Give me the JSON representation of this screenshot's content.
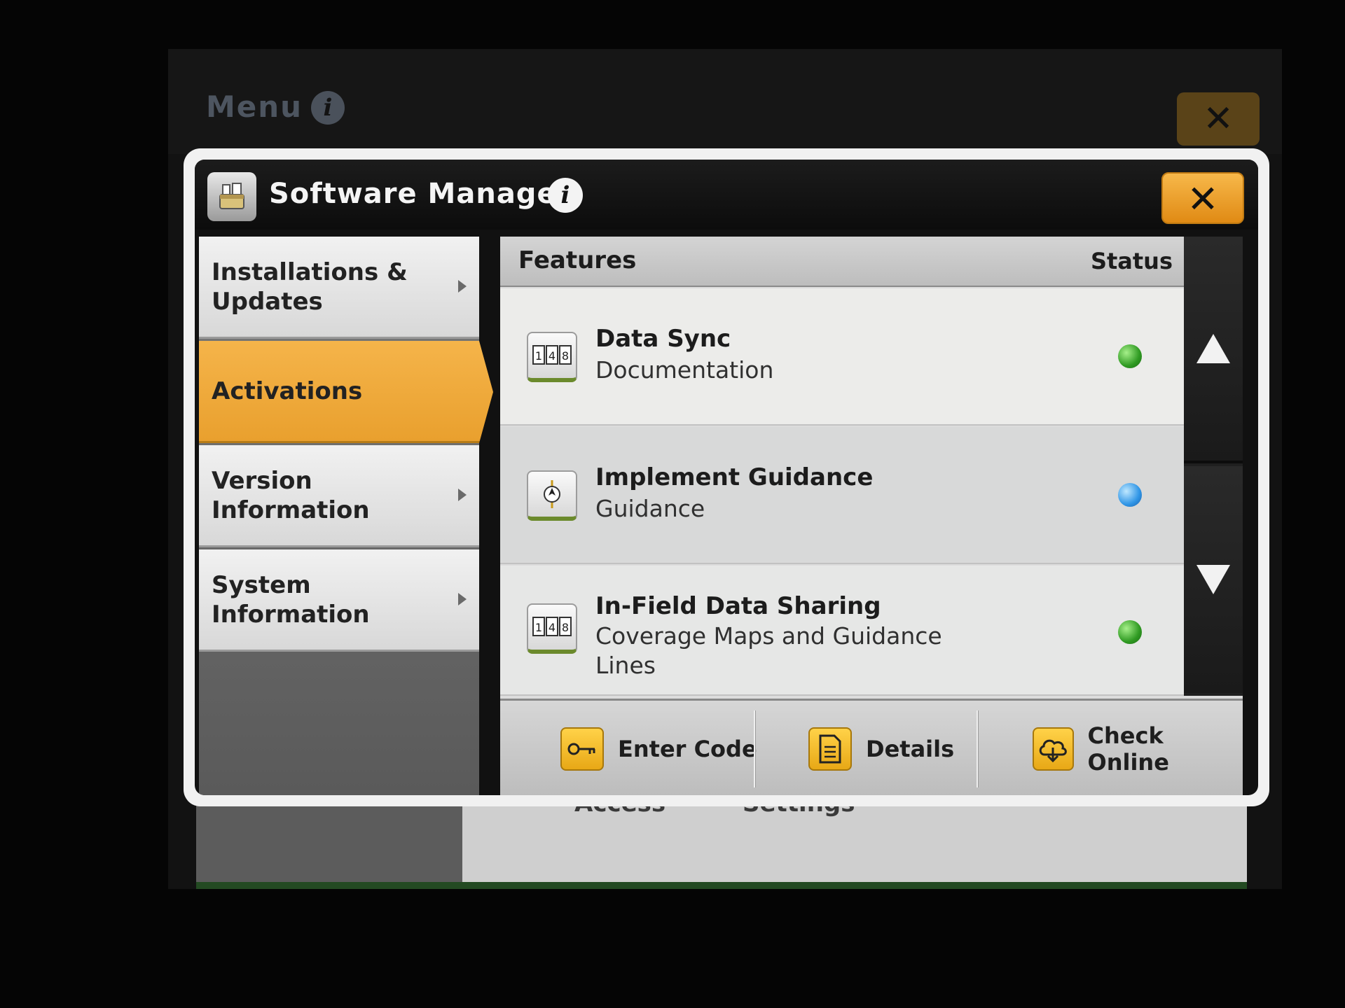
{
  "background": {
    "menu_title": "Menu",
    "info_glyph": "i",
    "close_glyph": "✕",
    "lower_labels": [
      "Access",
      "Settings"
    ]
  },
  "dialog": {
    "title": "Software Manager",
    "info_glyph": "i",
    "close_glyph": "✕"
  },
  "sidebar": {
    "items": [
      {
        "label": "Installations & Updates",
        "active": false
      },
      {
        "label": "Activations",
        "active": true
      },
      {
        "label": "Version Information",
        "active": false
      },
      {
        "label": "System Information",
        "active": false
      }
    ]
  },
  "table": {
    "header_features": "Features",
    "header_status": "Status",
    "rows": [
      {
        "name": "Data Sync",
        "description": "Documentation",
        "status": "green",
        "icon": "counter-icon",
        "icon_digits": "148"
      },
      {
        "name": "Implement Guidance",
        "description": "Guidance",
        "status": "blue",
        "icon": "implement-guidance-icon"
      },
      {
        "name": "In-Field Data Sharing",
        "description": "Coverage Maps and Guidance Lines",
        "status": "green",
        "icon": "counter-icon",
        "icon_digits": "148"
      }
    ]
  },
  "toolbar": {
    "enter_code": "Enter Code",
    "details": "Details",
    "check_online": "Check Online"
  },
  "colors": {
    "accent": "#f0a830",
    "status_green": "#2f9a22",
    "status_blue": "#2f95e6"
  }
}
